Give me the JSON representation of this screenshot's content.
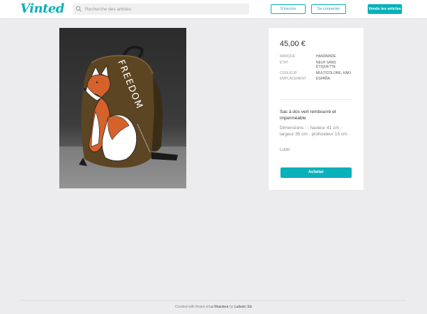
{
  "header": {
    "logo": "Vinted",
    "search_placeholder": "Recherche des articles",
    "signup_label": "S'inscrire",
    "login_label": "Se connecter",
    "sell_label": "Vends tes articles"
  },
  "product": {
    "image_caption": "FREEDOM",
    "price": "45,00 €",
    "details": [
      {
        "key": "MARQUE",
        "value": "HANDMADE"
      },
      {
        "key": "ÉTAT",
        "value": "NEUF SANS ÉTIQUETTE"
      },
      {
        "key": "COULEUR",
        "value": "MULTICOLORE, KAKI"
      },
      {
        "key": "EMPLACEMENT",
        "value": "ESPAÑA"
      }
    ],
    "title": "Sac à dos vert rembourré et imperméable",
    "description": "Dimensions : - hauteur 41 cm - largeur 35 cm - profondeur 15 cm.",
    "seller": "Ludo",
    "buy_label": "Acheter"
  },
  "footer": {
    "prefix": "Created with React at",
    "school": "Le Reacteur",
    "by": "by",
    "author": "Ludovic Six"
  },
  "colors": {
    "brand": "#09b1ba",
    "background": "#ececee"
  }
}
